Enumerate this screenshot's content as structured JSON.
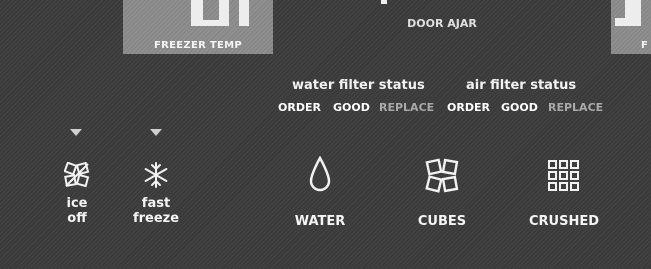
{
  "panels": {
    "freezer_temp_label": "FREEZER TEMP",
    "door_ajar_label": "DOOR AJAR",
    "right_panel_label": "F"
  },
  "water_filter": {
    "title": "water filter status",
    "order": "ORDER",
    "good": "GOOD",
    "replace": "REPLACE"
  },
  "air_filter": {
    "title": "air filter status",
    "order": "ORDER",
    "good": "GOOD",
    "replace": "REPLACE"
  },
  "buttons": {
    "ice_off": {
      "line1": "ice",
      "line2": "off",
      "icon": "ice-off-icon"
    },
    "fast_freeze": {
      "line1": "fast",
      "line2": "freeze",
      "icon": "snowflake-icon"
    },
    "water": {
      "label": "WATER",
      "icon": "water-drop-icon"
    },
    "cubes": {
      "label": "CUBES",
      "icon": "cubes-icon"
    },
    "crushed": {
      "label": "CRUSHED",
      "icon": "crushed-ice-icon"
    }
  },
  "colors": {
    "background": "#3a3a3a",
    "panel": "#8f8f8f",
    "text": "#f2f2f2",
    "dim_text": "#a9a9a9"
  }
}
